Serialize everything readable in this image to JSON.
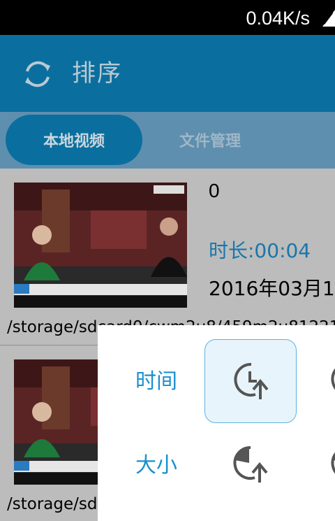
{
  "status_bar": {
    "net_speed": "0.04K/s"
  },
  "app_bar": {
    "title": "排序"
  },
  "tabs": [
    {
      "label": "本地视频",
      "active": true
    },
    {
      "label": "文件管理",
      "active": false
    }
  ],
  "videos": [
    {
      "name": "0",
      "duration": "时长:00:04",
      "date": "2016年03月1",
      "path": "/storage/sdcard0/cwm2u8/459m2u81221"
    },
    {
      "path": "/storage/sd"
    }
  ],
  "sort_popup": {
    "rows": [
      {
        "label": "时间"
      },
      {
        "label": "大小"
      }
    ]
  },
  "colors": {
    "app_bar": "#0a6f9e",
    "tab_bar": "#5f8faf",
    "accent": "#1a8fd0",
    "list_bg": "#bcbcbc"
  }
}
